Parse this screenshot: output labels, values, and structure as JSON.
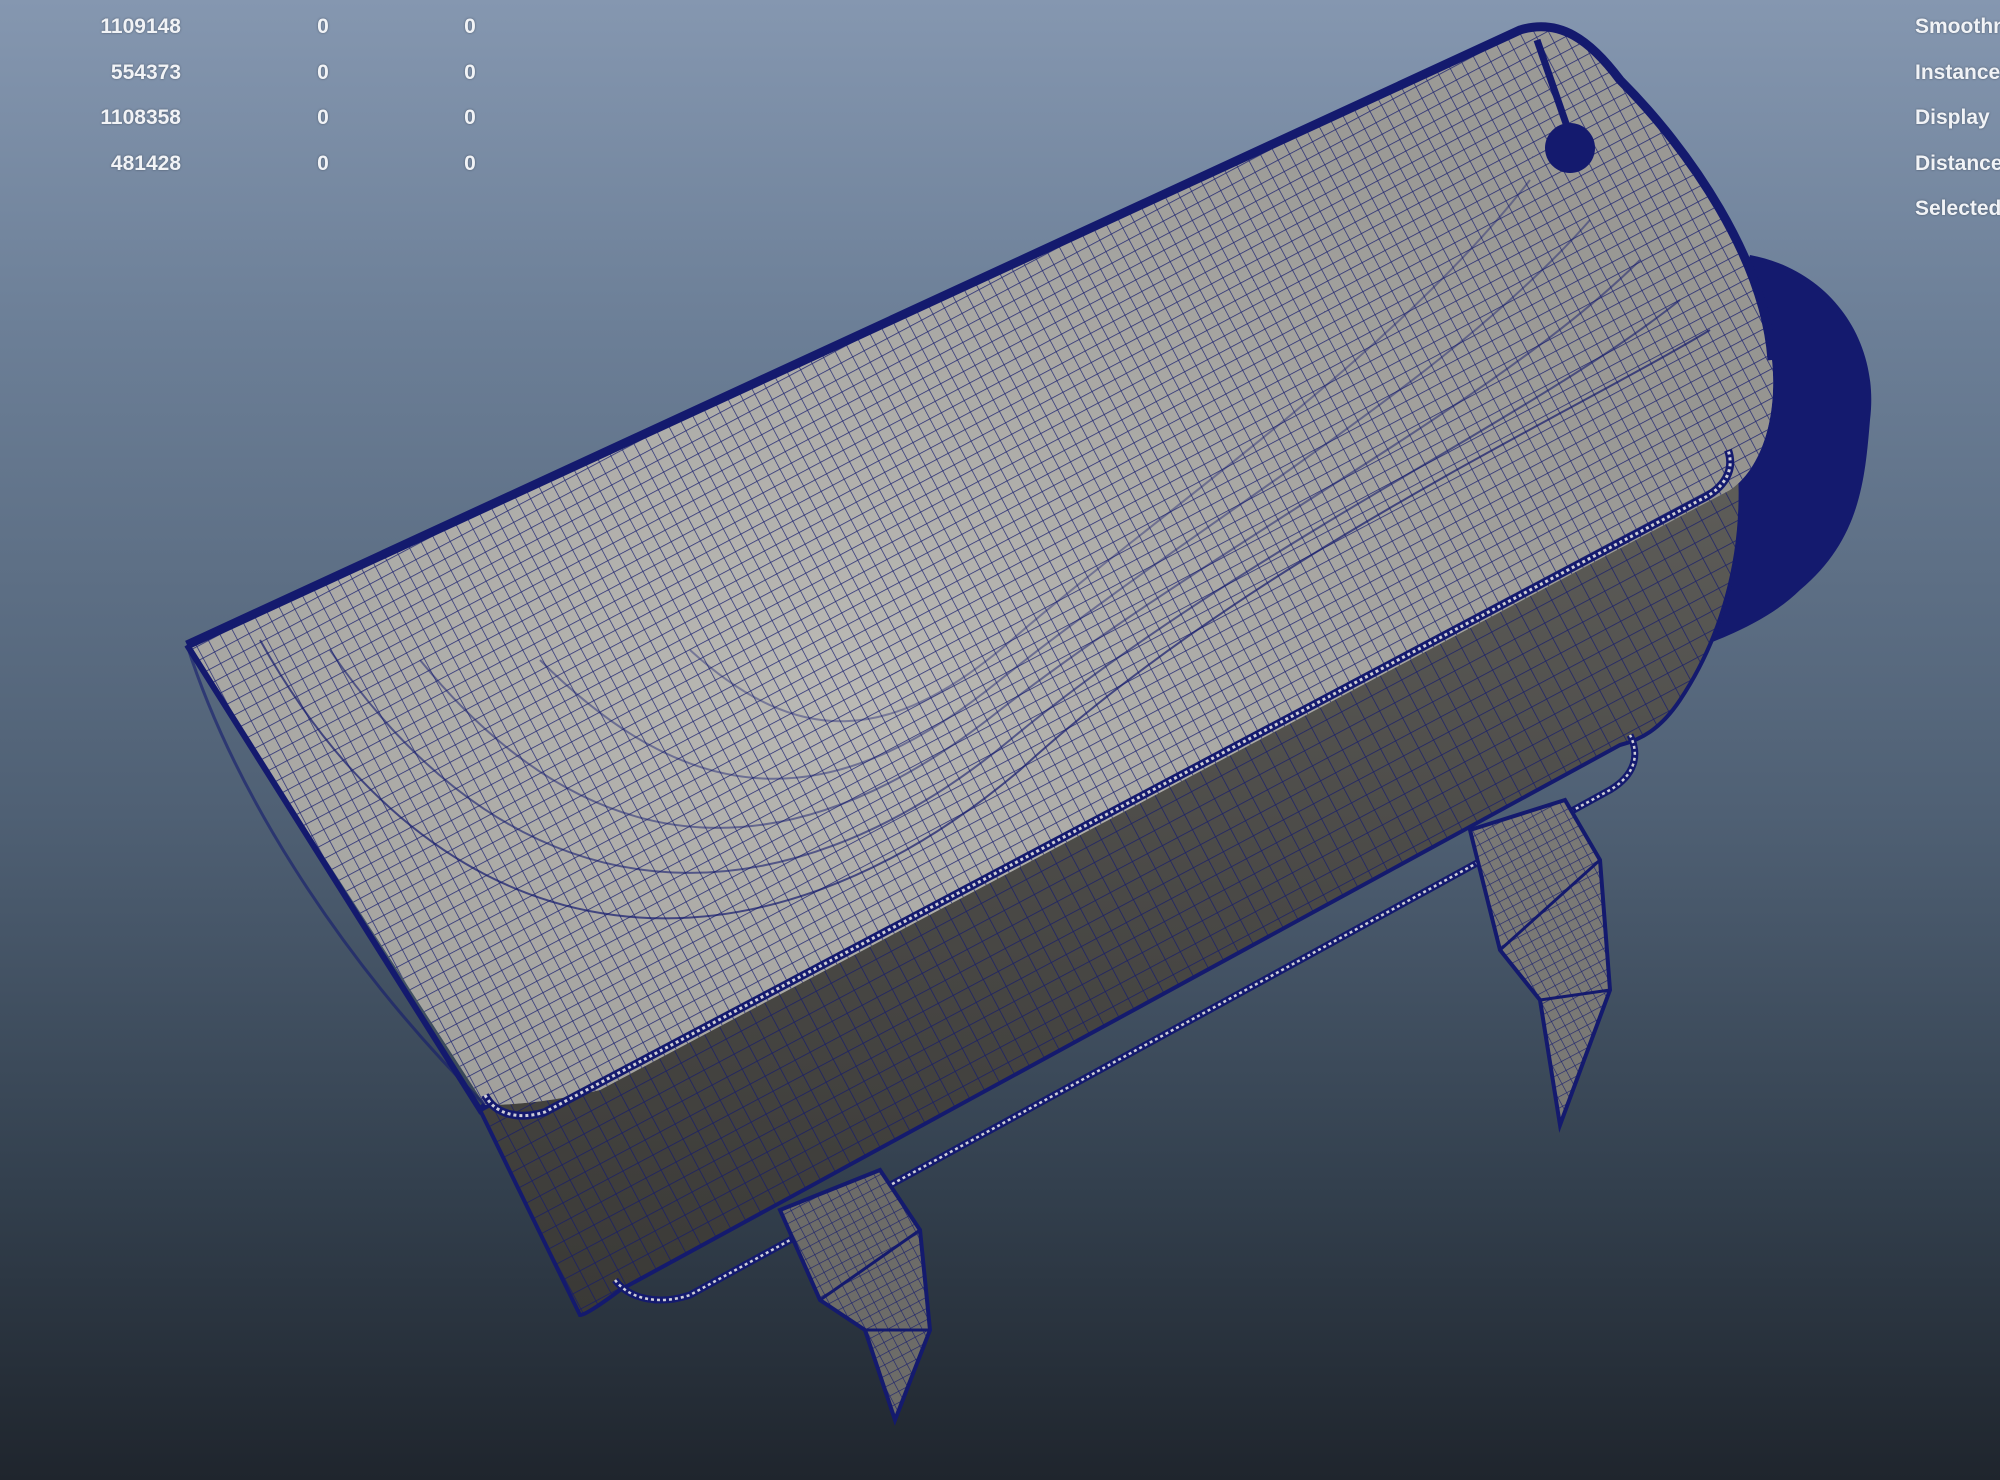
{
  "viewport": {
    "background_top": "#8597b0",
    "background_bottom": "#1f252d",
    "wire_color": "#141a6e",
    "surface_light": "#b5b3ae",
    "surface_dark": "#4a4946"
  },
  "hud": {
    "stats_rows": [
      [
        "1109148",
        "0",
        "0"
      ],
      [
        "554373",
        "0",
        "0"
      ],
      [
        "1108358",
        "0",
        "0"
      ],
      [
        "481428",
        "0",
        "0"
      ]
    ],
    "labels": [
      "Smoothness",
      "Instances",
      "Display",
      "Distance",
      "Selected"
    ]
  }
}
